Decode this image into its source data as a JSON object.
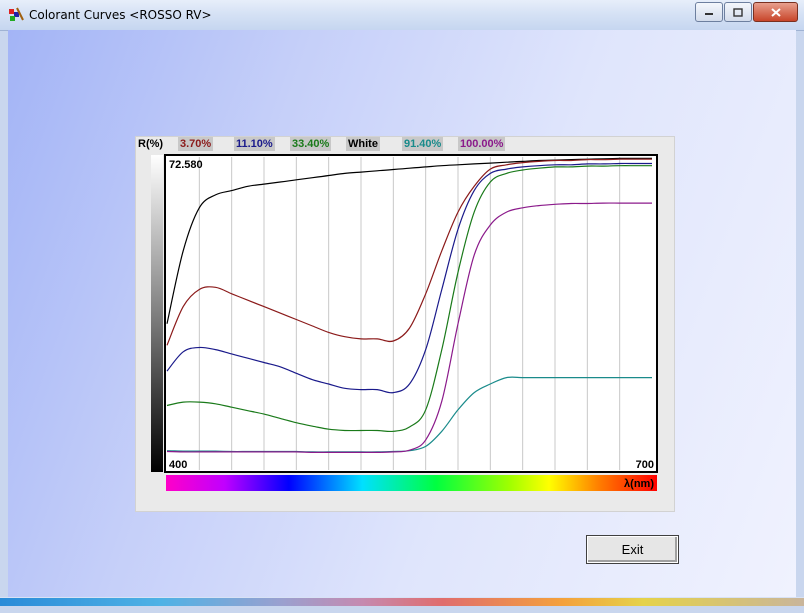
{
  "window": {
    "title": "Colorant Curves <ROSSO RV>",
    "minimize_icon": "minimize-icon",
    "maximize_icon": "maximize-icon",
    "close_icon": "close-icon"
  },
  "legend": {
    "axis_label": "R(%)",
    "items": [
      {
        "label": "3.70%",
        "color": "#8b1a1a"
      },
      {
        "label": "11.10%",
        "color": "#1a1a8b"
      },
      {
        "label": "33.40%",
        "color": "#1a7a1a"
      },
      {
        "label": "White",
        "color": "#000000"
      },
      {
        "label": "91.40%",
        "color": "#1a8b8b"
      },
      {
        "label": "100.00%",
        "color": "#8b1a8b"
      }
    ]
  },
  "chart_data": {
    "type": "line",
    "ylabel": "R(%)",
    "xlabel": "λ(nm)",
    "xlim": [
      400,
      700
    ],
    "ylim": [
      0,
      72.58
    ],
    "y_max_label": "72.580",
    "x_min_label": "400",
    "x_max_label": "700",
    "grid": "vertical",
    "x": [
      400,
      410,
      420,
      430,
      440,
      450,
      460,
      470,
      480,
      490,
      500,
      510,
      520,
      530,
      540,
      550,
      560,
      570,
      580,
      590,
      600,
      610,
      620,
      630,
      640,
      650,
      660,
      670,
      680,
      690,
      700
    ],
    "series": [
      {
        "name": "White",
        "color": "#000000",
        "values": [
          34,
          51,
          61,
          64,
          65,
          66,
          66.5,
          67,
          67.5,
          68,
          68.5,
          69,
          69.3,
          69.6,
          69.9,
          70.2,
          70.5,
          70.8,
          71,
          71.2,
          71.4,
          71.6,
          71.8,
          72,
          72.1,
          72.2,
          72.3,
          72.4,
          72.5,
          72.5,
          72.5
        ]
      },
      {
        "name": "3.70%",
        "color": "#8b1a1a",
        "values": [
          29,
          38,
          42,
          42.5,
          41,
          39.5,
          38,
          36.5,
          35,
          33.5,
          32,
          31,
          30.5,
          30.5,
          30,
          33,
          41,
          51,
          60,
          66,
          70,
          71,
          71.5,
          71.8,
          72,
          72,
          72.2,
          72.2,
          72.3,
          72.3,
          72.3
        ]
      },
      {
        "name": "11.10%",
        "color": "#1a1a8b",
        "values": [
          23,
          27.5,
          28.5,
          28,
          27,
          26,
          25,
          24,
          22.5,
          21,
          20,
          19,
          18.7,
          18.7,
          18,
          20,
          28,
          42,
          56,
          65,
          69,
          70,
          70.5,
          70.8,
          71,
          71,
          71.2,
          71.2,
          71.3,
          71.3,
          71.3
        ]
      },
      {
        "name": "33.40%",
        "color": "#1a7a1a",
        "values": [
          15,
          15.8,
          15.8,
          15.4,
          14.6,
          13.8,
          13,
          12,
          11,
          10.2,
          9.5,
          9.2,
          9.2,
          9.2,
          9,
          10,
          14,
          28,
          46,
          60,
          67,
          69,
          69.8,
          70.2,
          70.5,
          70.5,
          70.7,
          70.7,
          70.8,
          70.8,
          70.8
        ]
      },
      {
        "name": "91.40%",
        "color": "#1a8b8b",
        "values": [
          4.5,
          4.4,
          4.4,
          4.4,
          4.3,
          4.3,
          4.3,
          4.3,
          4.3,
          4.2,
          4.2,
          4.2,
          4.2,
          4.2,
          4.3,
          4.5,
          5.5,
          9,
          14,
          18,
          20,
          21.5,
          21.5,
          21.5,
          21.5,
          21.5,
          21.5,
          21.5,
          21.5,
          21.5,
          21.5
        ]
      },
      {
        "name": "100.00%",
        "color": "#8b1a8b",
        "values": [
          4.3,
          4.2,
          4.2,
          4.2,
          4.2,
          4.2,
          4.2,
          4.2,
          4.2,
          4.1,
          4.1,
          4.1,
          4.1,
          4.1,
          4.2,
          4.6,
          7,
          16,
          34,
          50,
          57,
          60,
          61,
          61.5,
          61.8,
          62,
          62,
          62.1,
          62.1,
          62.1,
          62.1
        ]
      }
    ]
  },
  "buttons": {
    "exit_label": "Exit"
  }
}
